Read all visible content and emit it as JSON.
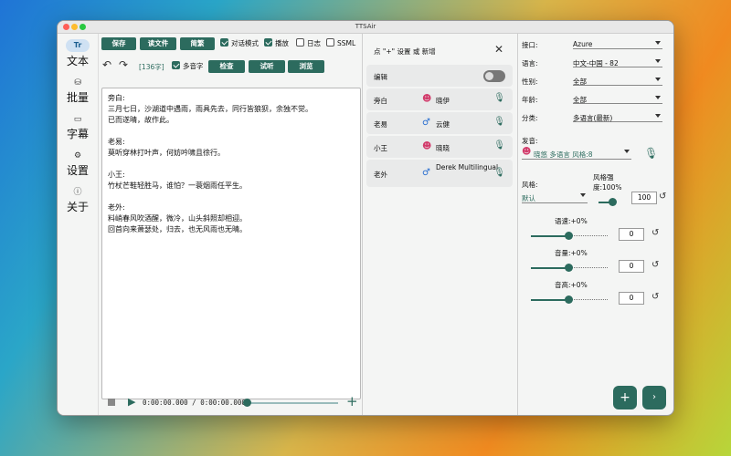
{
  "window": {
    "title": "TTSAir"
  },
  "sidebar": {
    "items": [
      {
        "label": "文本",
        "icon": "text-icon",
        "glyph": "Tr"
      },
      {
        "label": "批量",
        "icon": "batch-icon",
        "glyph": "⛁"
      },
      {
        "label": "字幕",
        "icon": "subtitle-icon",
        "glyph": "▭"
      },
      {
        "label": "设置",
        "icon": "gear-icon",
        "glyph": "⚙"
      },
      {
        "label": "关于",
        "icon": "info-icon",
        "glyph": "ⓘ"
      }
    ]
  },
  "toolbar": {
    "save": "保存",
    "read_file": "读文件",
    "simplified": "简繁",
    "dialog_mode": "对话模式",
    "play": "播放",
    "log": "日志",
    "ssml": "SSML",
    "char_count": "[136字]",
    "polyphone": "多音字",
    "check": "检查",
    "listen": "试听",
    "browse": "浏览"
  },
  "editor": {
    "paragraphs": [
      [
        "旁白:",
        "三月七日，沙湖道中遇雨，雨具先去，同行皆狼狈，余独不觉。",
        "已而遂晴，故作此。"
      ],
      [
        "老易:",
        "莫听穿林打叶声，何妨吟啸且徐行。"
      ],
      [
        "小王:",
        "竹杖芒鞋轻胜马，谁怕？一蓑烟雨任平生。"
      ],
      [
        "老外:",
        "料峭春风吹酒醒，微冷，山头斜照却相迎。",
        "回首向来萧瑟处，归去，也无风雨也无晴。"
      ]
    ]
  },
  "player": {
    "time": "0:00:00.000 / 0:00:00.000"
  },
  "roles": {
    "header": "点 \"+\" 设置 或 新增",
    "edit_label": "编辑",
    "items": [
      {
        "role": "旁白",
        "voice": "晓伊",
        "gender": "female"
      },
      {
        "role": "老易",
        "voice": "云健",
        "gender": "male"
      },
      {
        "role": "小王",
        "voice": "晓晓",
        "gender": "female"
      },
      {
        "role": "老外",
        "voice": "Derek Multilingual",
        "gender": "male"
      }
    ]
  },
  "settings": {
    "interface_label": "接口:",
    "interface": "Azure",
    "language_label": "语言:",
    "language": "中文-中国 - 82",
    "gender_label": "性别:",
    "gender": "全部",
    "age_label": "年龄:",
    "age": "全部",
    "category_label": "分类:",
    "category": "多语言(最新)",
    "voice_label": "发音:",
    "voice": "晓悠 多语言 风格:8",
    "style_label": "风格:",
    "style": "默认",
    "style_strength_label": "风格强度:100%",
    "style_strength": "100",
    "rate_label": "语速:+0%",
    "rate": "0",
    "volume_label": "音量:+0%",
    "volume": "0",
    "pitch_label": "音高:+0%",
    "pitch": "0"
  },
  "colors": {
    "accent": "#2c6b5e",
    "warning_red": "#d42020"
  }
}
